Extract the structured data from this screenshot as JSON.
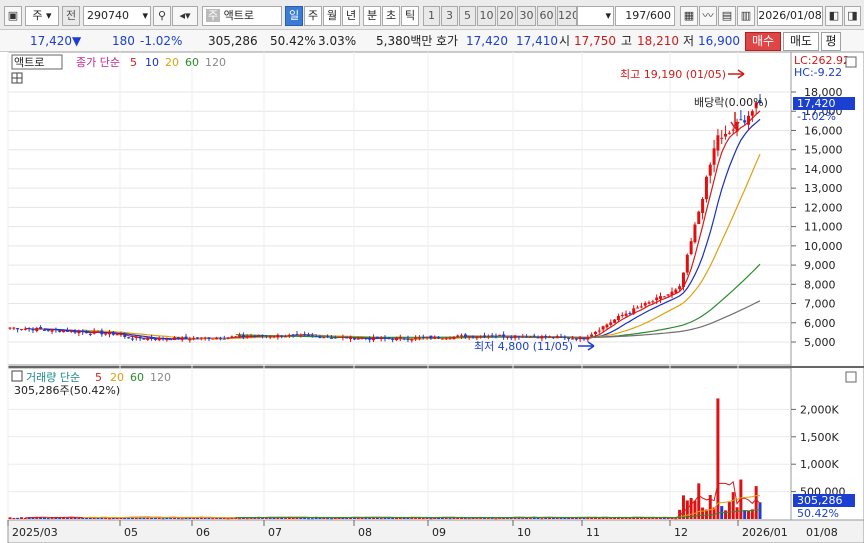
{
  "toolbar": {
    "market_select": "주",
    "code_prefix": "전",
    "code": "290740",
    "stock_tag": "주",
    "stock_name": "액트로",
    "periods": [
      "일",
      "주",
      "월",
      "년"
    ],
    "active_period": "일",
    "intraday": [
      "분",
      "초",
      "틱"
    ],
    "intervals": [
      "1",
      "3",
      "5",
      "10",
      "20",
      "30",
      "60",
      "120"
    ],
    "bar_count": "197/600",
    "date": "2026/01/08"
  },
  "quote": {
    "price": "17,420",
    "change_arrow": "▼",
    "change": "180",
    "change_pct": "-1.02%",
    "volume": "305,286",
    "volume_ratio": "50.42%",
    "turnover_pct": "3.03%",
    "amount": "5,380백만",
    "hoga_label": "호가",
    "ask": "17,420",
    "bid": "17,410",
    "open_label": "시",
    "open": "17,750",
    "high_label": "고",
    "high": "18,210",
    "low_label": "저",
    "low": "16,900",
    "buy_label": "매수",
    "sell_label": "매도",
    "eval_label": "평"
  },
  "price_panel": {
    "name_tag": "액트로",
    "ma_title": "종가 단순",
    "ma_periods": [
      "5",
      "10",
      "20",
      "60",
      "120"
    ],
    "max_label": "최고 19,190 (01/05)",
    "min_label": "최저 4,800 (11/05)",
    "dividend_label": "배당락(0.00%)",
    "lc": "LC:262.92",
    "hc": "HC:-9.22",
    "current_tag": "17,420",
    "current_pct": "-1.02%",
    "ticks": [
      "18,000",
      "17,000",
      "16,000",
      "15,000",
      "14,000",
      "13,000",
      "12,000",
      "11,000",
      "10,000",
      "9,000",
      "8,000",
      "7,000",
      "6,000",
      "5,000"
    ]
  },
  "volume_panel": {
    "title": "거래량 단순",
    "ma_periods": [
      "5",
      "20",
      "60",
      "120"
    ],
    "info": "305,286주(50.42%)",
    "ticks": [
      "2,000K",
      "1,500K",
      "1,000K",
      "500,000"
    ],
    "current_tag": "305,286",
    "current_pct": "50.42%"
  },
  "x_axis": {
    "labels": [
      "2025/03",
      "05",
      "06",
      "07",
      "08",
      "09",
      "10",
      "11",
      "12",
      "2026/01"
    ],
    "right_label": "01/08"
  },
  "colors": {
    "up": "#e01010",
    "down": "#1a3fd1",
    "ma5": "#d01e1e",
    "ma10": "#1a2fc0",
    "ma20": "#e0a010",
    "ma60": "#2e8b2e",
    "ma120": "#707070"
  },
  "chart_data": {
    "type": "line",
    "title": "액트로",
    "ylim": [
      4300,
      19500
    ],
    "x": [
      "2025/03",
      "05",
      "06",
      "07",
      "08",
      "09",
      "10",
      "11",
      "12",
      "2026/01"
    ],
    "series": [
      {
        "name": "종가",
        "values": [
          5700,
          5300,
          5150,
          5300,
          5400,
          5200,
          5300,
          5200,
          8000,
          17420
        ]
      }
    ],
    "volume_ylim": [
      0,
      2500000
    ]
  }
}
